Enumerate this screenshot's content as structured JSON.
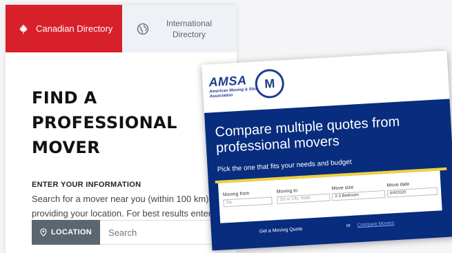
{
  "tabs": {
    "active_label": "Canadian Directory",
    "inactive_label": "International Directory"
  },
  "main": {
    "title": "FIND A PROFESSIONAL MOVER",
    "section_label": "ENTER YOUR INFORMATION",
    "description": "Search for a mover near you (within 100 km) by providing your location. For best results enter the postal code.",
    "location_button": "LOCATION",
    "search_placeholder": "Search"
  },
  "amsa": {
    "logo_text": "AMSA",
    "logo_subtext": "American Moving & Storage Association",
    "badge_letter": "M",
    "headline": "Compare multiple quotes from professional movers",
    "subline": "Pick the one that fits your needs and budget",
    "form": {
      "moving_from_label": "Moving from",
      "moving_from_placeholder": "Zip",
      "moving_to_label": "Moving to",
      "moving_to_placeholder": "Zip or City, State",
      "move_size_label": "Move size",
      "move_size_value": "2-3 Bedroom",
      "move_date_label": "Move date",
      "move_date_value": "6/4/2020"
    },
    "quote_button": "Get a Moving Quote",
    "or_text": "or",
    "compare_link": "Compare Movers"
  },
  "colors": {
    "brand_red": "#d8202b",
    "amsa_blue": "#082c7e",
    "accent_yellow": "#f2d13b"
  }
}
